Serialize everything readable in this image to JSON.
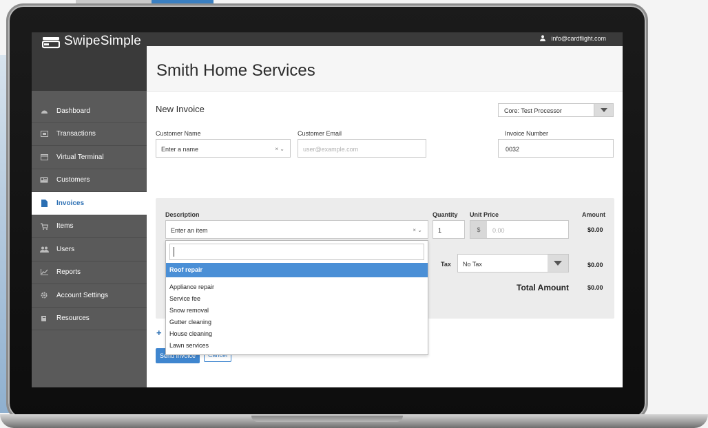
{
  "app": {
    "brand": "SwipeSimple",
    "user_email": "info@cardflight.com",
    "business_name": "Smith Home Services"
  },
  "sidebar": {
    "items": [
      {
        "label": "Dashboard",
        "icon": "dashboard-icon",
        "active": false
      },
      {
        "label": "Transactions",
        "icon": "transactions-icon",
        "active": false
      },
      {
        "label": "Virtual Terminal",
        "icon": "terminal-icon",
        "active": false
      },
      {
        "label": "Customers",
        "icon": "customers-icon",
        "active": false
      },
      {
        "label": "Invoices",
        "icon": "invoice-icon",
        "active": true
      },
      {
        "label": "Items",
        "icon": "cart-icon",
        "active": false
      },
      {
        "label": "Users",
        "icon": "users-icon",
        "active": false
      },
      {
        "label": "Reports",
        "icon": "chart-icon",
        "active": false
      },
      {
        "label": "Account Settings",
        "icon": "gear-icon",
        "active": false
      },
      {
        "label": "Resources",
        "icon": "book-icon",
        "active": false
      }
    ]
  },
  "invoice": {
    "title": "New Invoice",
    "processor": "Core: Test Processor",
    "customer_name": {
      "label": "Customer Name",
      "placeholder": "Enter a name"
    },
    "customer_email": {
      "label": "Customer Email",
      "placeholder": "user@example.com"
    },
    "invoice_number": {
      "label": "Invoice Number",
      "value": "0032"
    },
    "items_header": {
      "description": "Description",
      "quantity": "Quantity",
      "unit_price": "Unit Price",
      "amount": "Amount"
    },
    "line": {
      "description_placeholder": "Enter an item",
      "quantity": "1",
      "currency": "$",
      "unit_price_placeholder": "0.00",
      "amount": "$0.00"
    },
    "tax": {
      "label": "Tax",
      "value": "No Tax",
      "amount": "$0.00"
    },
    "total": {
      "label": "Total Amount",
      "amount": "$0.00"
    },
    "send_label": "Send Invoice",
    "cancel_label": "Cancel",
    "clear_symbol": "× ⌄"
  },
  "dropdown": {
    "highlighted": "Roof repair",
    "options": [
      "Appliance repair",
      "Service fee",
      "Snow removal",
      "Gutter cleaning",
      "House cleaning",
      "Lawn services"
    ]
  },
  "colors": {
    "accent": "#3f86cf",
    "sidebar": "#5a5a5a",
    "sidebar_dark": "#3a3a3a",
    "highlight": "#4a8fd6"
  }
}
